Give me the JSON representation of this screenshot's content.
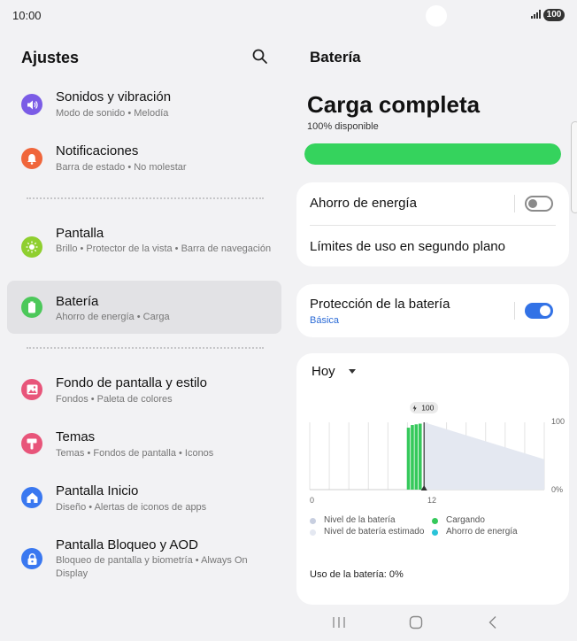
{
  "status_bar": {
    "time": "10:00",
    "battery": "100"
  },
  "left": {
    "title": "Ajustes",
    "items": [
      {
        "title": "Sonidos y vibración",
        "subtitle": "Modo de sonido  •  Melodía",
        "color": "#7b5ce6"
      },
      {
        "title": "Notificaciones",
        "subtitle": "Barra de estado  •  No molestar",
        "color": "#f0663b"
      },
      {
        "title": "Pantalla",
        "subtitle": "Brillo  •  Protector de la vista  •  Barra de navegación",
        "color": "#8fcf2f"
      },
      {
        "title": "Batería",
        "subtitle": "Ahorro de energía  •  Carga",
        "color": "#4cc85a"
      },
      {
        "title": "Fondo de pantalla y estilo",
        "subtitle": "Fondos  •  Paleta de colores",
        "color": "#e8557a"
      },
      {
        "title": "Temas",
        "subtitle": "Temas  •  Fondos de pantalla  •  Iconos",
        "color": "#e8557a"
      },
      {
        "title": "Pantalla Inicio",
        "subtitle": "Diseño  •  Alertas de iconos de apps",
        "color": "#3a78f0"
      },
      {
        "title": "Pantalla Bloqueo y AOD",
        "subtitle": "Bloqueo de pantalla y biometría  •  Always On Display",
        "color": "#3a78f0"
      }
    ]
  },
  "right": {
    "title": "Batería",
    "headline": "Carga completa",
    "available": "100% disponible",
    "level_fraction": 1.0,
    "power_saving": {
      "label": "Ahorro de energía",
      "enabled": false
    },
    "background_limits": "Límites de uso en segundo plano",
    "protection": {
      "label": "Protección de la batería",
      "sub": "Básica",
      "enabled": true
    },
    "period": "Hoy",
    "usage": "Uso de la batería: 0%"
  },
  "chart_data": {
    "type": "area",
    "x_ticks": [
      "0",
      "12"
    ],
    "y_ticks": [
      "100",
      "0%"
    ],
    "marker_label": "100",
    "legend": [
      {
        "label": "Nivel de la batería",
        "color": "#c8cfe0"
      },
      {
        "label": "Nivel de batería estimado",
        "color": "#e4e8f1"
      },
      {
        "label": "Cargando",
        "color": "#35c95b"
      },
      {
        "label": "Ahorro de energía",
        "color": "#29c3d8"
      }
    ],
    "x_range": [
      0,
      24
    ],
    "y_range": [
      0,
      100
    ],
    "charging_bars": [
      {
        "x": 10.1,
        "y": 92
      },
      {
        "x": 10.5,
        "y": 96
      },
      {
        "x": 10.9,
        "y": 97
      },
      {
        "x": 11.3,
        "y": 98
      }
    ],
    "current_x": 11.7,
    "estimated_line": [
      {
        "x": 11.7,
        "y": 100
      },
      {
        "x": 24,
        "y": 45
      }
    ]
  }
}
